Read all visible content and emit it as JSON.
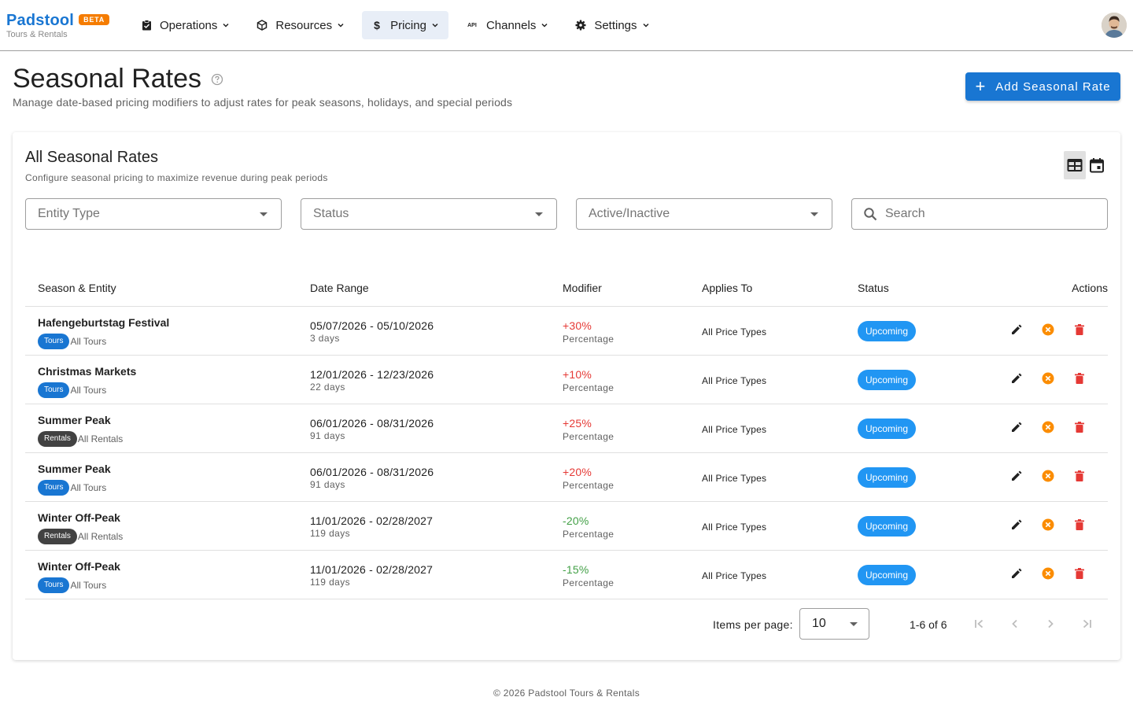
{
  "brand": {
    "name": "Padstool",
    "badge": "BETA",
    "subtitle": "Tours & Rentals"
  },
  "nav": [
    {
      "label": "Operations",
      "icon": "clipboard-check-icon"
    },
    {
      "label": "Resources",
      "icon": "cube-icon"
    },
    {
      "label": "Pricing",
      "icon": "dollar-icon",
      "active": true
    },
    {
      "label": "Channels",
      "icon": "api-icon"
    },
    {
      "label": "Settings",
      "icon": "gear-icon"
    }
  ],
  "header": {
    "title": "Seasonal Rates",
    "subtitle": "Manage date-based pricing modifiers to adjust rates for peak seasons, holidays, and special periods",
    "add_button": "Add Seasonal Rate"
  },
  "card": {
    "title": "All Seasonal Rates",
    "subtitle": "Configure seasonal pricing to maximize revenue during peak periods"
  },
  "filters": {
    "entity_type": "Entity Type",
    "status": "Status",
    "active_inactive": "Active/Inactive",
    "search_placeholder": "Search"
  },
  "table": {
    "headers": [
      "Season & Entity",
      "Date Range",
      "Modifier",
      "Applies To",
      "Status",
      "Actions"
    ],
    "rows": [
      {
        "name": "Hafengeburtstag Festival",
        "chip": "Tours",
        "entity": "All Tours",
        "date_range": "05/07/2026 - 05/10/2026",
        "days": "3 days",
        "modifier": "+30%",
        "modifier_type": "Percentage",
        "applies_to": "All Price Types",
        "status": "Upcoming"
      },
      {
        "name": "Christmas Markets",
        "chip": "Tours",
        "entity": "All Tours",
        "date_range": "12/01/2026 - 12/23/2026",
        "days": "22 days",
        "modifier": "+10%",
        "modifier_type": "Percentage",
        "applies_to": "All Price Types",
        "status": "Upcoming"
      },
      {
        "name": "Summer Peak",
        "chip": "Rentals",
        "entity": "All Rentals",
        "date_range": "06/01/2026 - 08/31/2026",
        "days": "91 days",
        "modifier": "+25%",
        "modifier_type": "Percentage",
        "applies_to": "All Price Types",
        "status": "Upcoming"
      },
      {
        "name": "Summer Peak",
        "chip": "Tours",
        "entity": "All Tours",
        "date_range": "06/01/2026 - 08/31/2026",
        "days": "91 days",
        "modifier": "+20%",
        "modifier_type": "Percentage",
        "applies_to": "All Price Types",
        "status": "Upcoming"
      },
      {
        "name": "Winter Off-Peak",
        "chip": "Rentals",
        "entity": "All Rentals",
        "date_range": "11/01/2026 - 02/28/2027",
        "days": "119 days",
        "modifier": "-20%",
        "modifier_type": "Percentage",
        "applies_to": "All Price Types",
        "status": "Upcoming"
      },
      {
        "name": "Winter Off-Peak",
        "chip": "Tours",
        "entity": "All Tours",
        "date_range": "11/01/2026 - 02/28/2027",
        "days": "119 days",
        "modifier": "-15%",
        "modifier_type": "Percentage",
        "applies_to": "All Price Types",
        "status": "Upcoming"
      }
    ]
  },
  "pagination": {
    "items_per_page_label": "Items per page:",
    "items_per_page": "10",
    "range": "1-6 of 6"
  },
  "footer": "© 2026 Padstool Tours & Rentals",
  "colors": {
    "primary": "#1976d2",
    "beta": "#f57c00",
    "status": "#2196f3",
    "increase": "#e53935",
    "decrease": "#43a047",
    "deactivate": "#fb8c00",
    "delete": "#e53935"
  }
}
